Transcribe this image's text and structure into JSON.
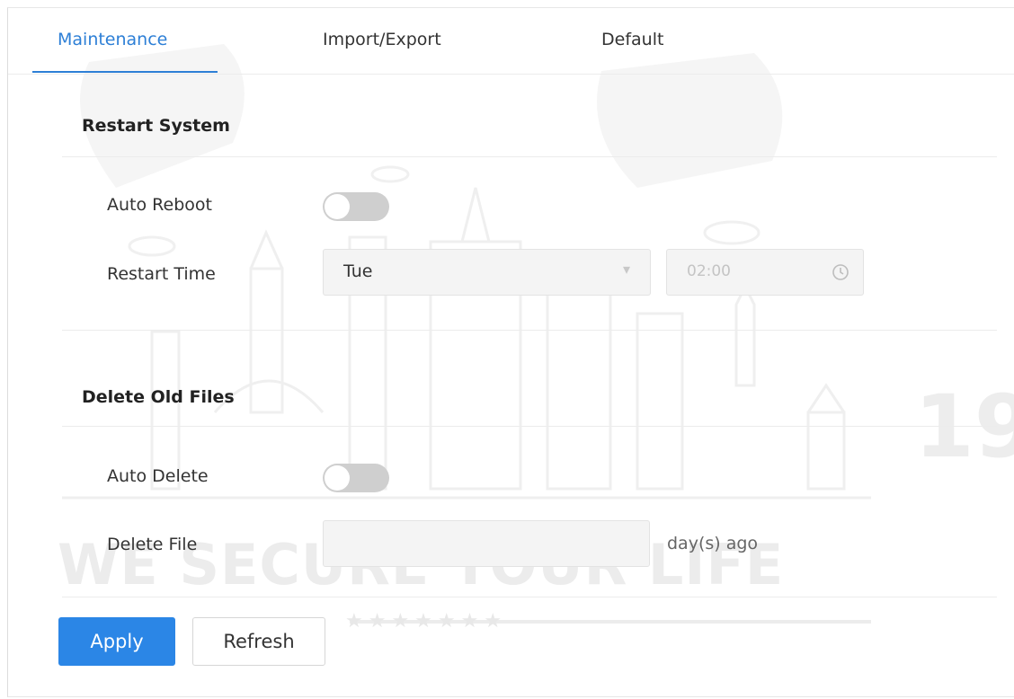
{
  "tabs": [
    {
      "label": "Maintenance",
      "active": true
    },
    {
      "label": "Import/Export",
      "active": false
    },
    {
      "label": "Default",
      "active": false
    }
  ],
  "restart_system": {
    "title": "Restart System",
    "auto_reboot_label": "Auto Reboot",
    "auto_reboot_enabled": false,
    "restart_time_label": "Restart Time",
    "restart_day": "Tue",
    "restart_time": "02:00"
  },
  "delete_old_files": {
    "title": "Delete Old Files",
    "auto_delete_label": "Auto Delete",
    "auto_delete_enabled": false,
    "delete_file_label": "Delete File",
    "delete_file_value": "",
    "delete_file_unit": "day(s) ago"
  },
  "actions": {
    "apply_label": "Apply",
    "refresh_label": "Refresh"
  },
  "colors": {
    "accent": "#2b86e6",
    "active_tab": "#2d7fd6",
    "toggle_off": "#cfcfcf"
  },
  "watermark": {
    "slogan": "WE SECURE YOUR LIFE",
    "stars": "★★★★★★★",
    "year_fragment": "19"
  }
}
